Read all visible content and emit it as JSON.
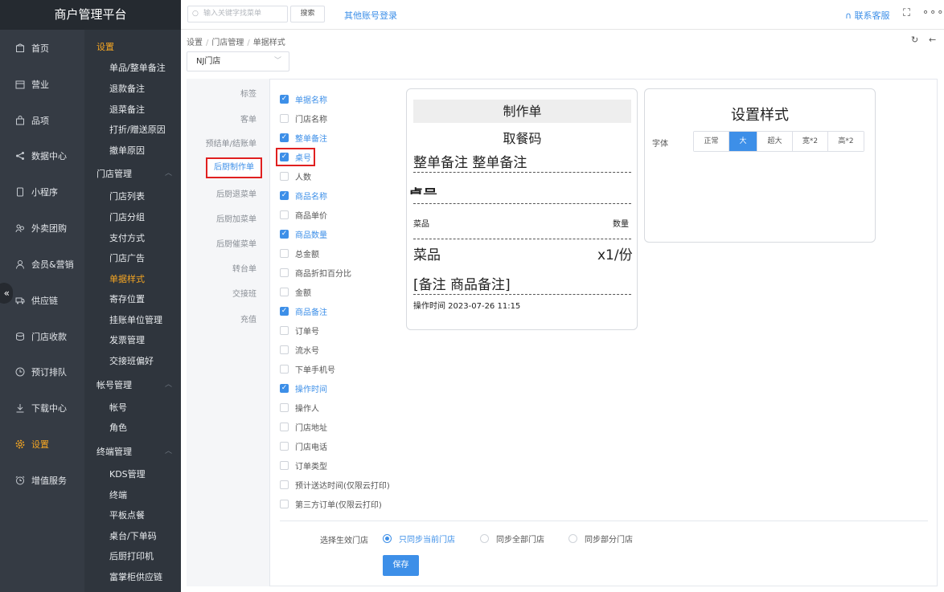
{
  "app": {
    "title": "商户管理平台"
  },
  "nav_primary": [
    {
      "label": "首页",
      "icon": "home-icon"
    },
    {
      "label": "营业",
      "icon": "calendar-icon"
    },
    {
      "label": "品项",
      "icon": "bag-icon"
    },
    {
      "label": "数据中心",
      "icon": "share-icon"
    },
    {
      "label": "小程序",
      "icon": "phone-icon"
    },
    {
      "label": "外卖团购",
      "icon": "group-icon"
    },
    {
      "label": "会员&营销",
      "icon": "user-icon"
    },
    {
      "label": "供应链",
      "icon": "truck-icon"
    },
    {
      "label": "门店收款",
      "icon": "wallet-icon"
    },
    {
      "label": "预订排队",
      "icon": "clock-icon"
    },
    {
      "label": "下载中心",
      "icon": "download-icon"
    },
    {
      "label": "设置",
      "icon": "gear-icon"
    },
    {
      "label": "增值服务",
      "icon": "alarm-icon"
    }
  ],
  "nav_collapse_glyph": "«",
  "nav_secondary": {
    "settings_head": "设置",
    "settings_items": [
      "单品/整单备注",
      "退款备注",
      "退菜备注",
      "打折/赠送原因",
      "撤单原因"
    ],
    "store_head": "门店管理",
    "store_items": [
      "门店列表",
      "门店分组",
      "支付方式",
      "门店广告",
      "单据样式",
      "寄存位置",
      "挂账单位管理",
      "发票管理",
      "交接班偏好"
    ],
    "account_head": "帐号管理",
    "account_items": [
      "帐号",
      "角色"
    ],
    "terminal_head": "终端管理",
    "terminal_items": [
      "KDS管理",
      "终端",
      "平板点餐",
      "桌台/下单码",
      "后厨打印机",
      "富掌柜供应链"
    ]
  },
  "topbar": {
    "search_placeholder": "输入关键字找菜单",
    "search_button": "搜索",
    "other_login": "其他账号登录",
    "contact": "联系客服"
  },
  "breadcrumb": [
    "设置",
    "门店管理",
    "单据样式"
  ],
  "store_select": "NJ门店",
  "doc_tabs": [
    "标签",
    "客单",
    "预结单/结账单",
    "后厨制作单",
    "后厨退菜单",
    "后厨加菜单",
    "后厨催菜单",
    "转台单",
    "交接班",
    "充值"
  ],
  "active_tab": "后厨制作单",
  "fields": [
    {
      "label": "单据名称",
      "checked": true
    },
    {
      "label": "门店名称",
      "checked": false
    },
    {
      "label": "整单备注",
      "checked": true
    },
    {
      "label": "桌号",
      "checked": true
    },
    {
      "label": "人数",
      "checked": false
    },
    {
      "label": "商品名称",
      "checked": true
    },
    {
      "label": "商品单价",
      "checked": false
    },
    {
      "label": "商品数量",
      "checked": true
    },
    {
      "label": "总金额",
      "checked": false
    },
    {
      "label": "商品折扣百分比",
      "checked": false
    },
    {
      "label": "金额",
      "checked": false
    },
    {
      "label": "商品备注",
      "checked": true
    },
    {
      "label": "订单号",
      "checked": false
    },
    {
      "label": "流水号",
      "checked": false
    },
    {
      "label": "下单手机号",
      "checked": false
    },
    {
      "label": "操作时间",
      "checked": true
    },
    {
      "label": "操作人",
      "checked": false
    },
    {
      "label": "门店地址",
      "checked": false
    },
    {
      "label": "门店电话",
      "checked": false
    },
    {
      "label": "订单类型",
      "checked": false
    },
    {
      "label": "预计送达时间(仅限云打印)",
      "checked": false
    },
    {
      "label": "第三方订单(仅限云打印)",
      "checked": false
    }
  ],
  "receipt": {
    "title": "制作单",
    "subtitle": "取餐码",
    "order_note": "整单备注 整单备注",
    "table_no": "桌号",
    "col_item": "菜品",
    "col_qty": "数量",
    "item_name": "菜品",
    "item_qty": "x1/份",
    "item_note": "[备注 商品备注]",
    "op_time": "操作时间 2023-07-26 11:15"
  },
  "style_panel": {
    "title": "设置样式",
    "font_label": "字体",
    "sizes": [
      "正常",
      "大",
      "超大",
      "宽*2",
      "高*2"
    ],
    "selected": "大"
  },
  "scope": {
    "label": "选择生效门店",
    "options": [
      "只同步当前门店",
      "同步全部门店",
      "同步部分门店"
    ],
    "selected": "只同步当前门店"
  },
  "save_label": "保存",
  "colors": {
    "accent": "#3d8fe8",
    "active_nav": "#f5a623",
    "highlight": "#e02020",
    "sidebar": "#2f353d"
  }
}
